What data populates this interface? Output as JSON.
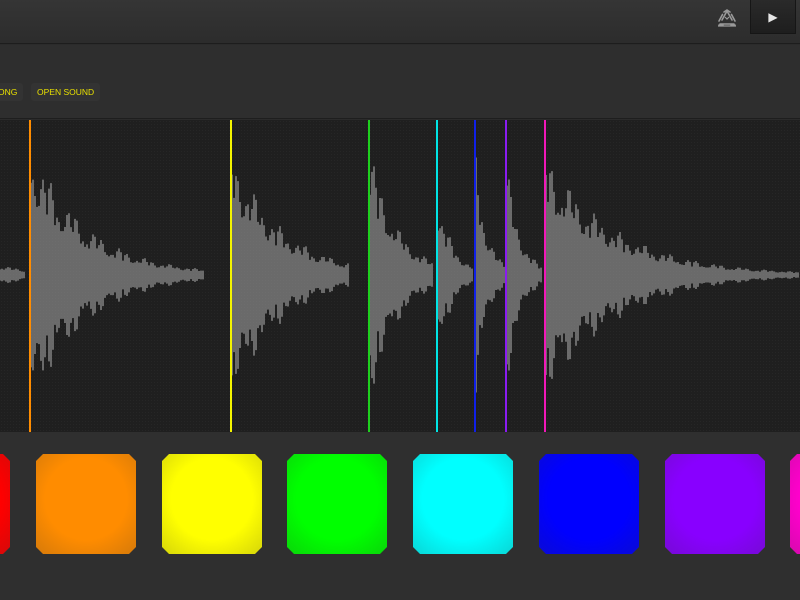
{
  "toolbar": {
    "song_label": "ONG",
    "open_sound_label": "OPEN SOUND"
  },
  "header": {
    "icons": [
      "recycle-icon",
      "play-icon"
    ],
    "play_glyph": "▶"
  },
  "colors": {
    "accent_text": "#e8e000",
    "wave": "#b4b4b4"
  },
  "markers": [
    {
      "color": "#ff8c00"
    },
    {
      "color": "#f4f400"
    },
    {
      "color": "#1ed01e"
    },
    {
      "color": "#00e4e4"
    },
    {
      "color": "#1020e8"
    },
    {
      "color": "#8a1cf0"
    },
    {
      "color": "#f018b8"
    }
  ],
  "pads": [
    {
      "name": "pad-red",
      "color": "#ff0000"
    },
    {
      "name": "pad-orange",
      "color": "#ff8c00"
    },
    {
      "name": "pad-yellow",
      "color": "#ffff00"
    },
    {
      "name": "pad-green",
      "color": "#00ff00"
    },
    {
      "name": "pad-cyan",
      "color": "#00ffff"
    },
    {
      "name": "pad-blue",
      "color": "#0000ff"
    },
    {
      "name": "pad-violet",
      "color": "#8800ff"
    },
    {
      "name": "pad-magenta",
      "color": "#ff00cc"
    }
  ]
}
